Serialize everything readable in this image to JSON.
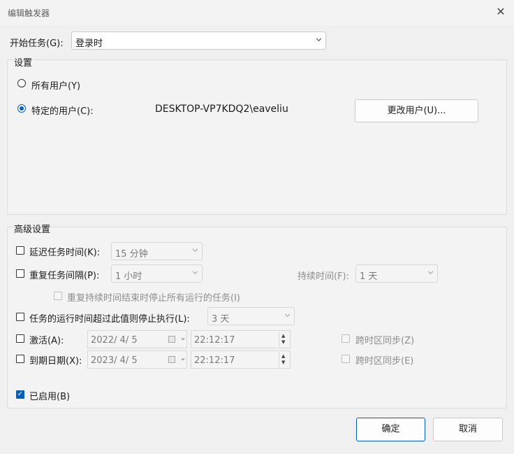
{
  "window": {
    "title": "编辑触发器",
    "close_icon": "close-icon"
  },
  "start_task": {
    "label": "开始任务(G):",
    "value": "登录时"
  },
  "settings": {
    "group_label": "设置",
    "all_users_label": "所有用户(Y)",
    "specific_user_label": "特定的用户(C):",
    "user_value": "DESKTOP-VP7KDQ2\\eaveliu",
    "change_user_button": "更改用户(U)..."
  },
  "advanced": {
    "group_label": "高级设置",
    "delay_label": "延迟任务时间(K):",
    "delay_value": "15 分钟",
    "repeat_label": "重复任务间隔(P):",
    "repeat_value": "1 小时",
    "duration_label": "持续时间(F):",
    "duration_value": "1 天",
    "stop_all_label": "重复持续时间结束时停止所有运行的任务(I)",
    "stop_if_label": "任务的运行时间超过此值则停止执行(L):",
    "stop_if_value": "3 天",
    "activate_label": "激活(A):",
    "activate_date": "2022/  4/  5",
    "activate_time": "22:12:17",
    "activate_sync_label": "跨时区同步(Z)",
    "expire_label": "到期日期(X):",
    "expire_date": "2023/  4/  5",
    "expire_time": "22:12:17",
    "expire_sync_label": "跨时区同步(E)",
    "enabled_label": "已启用(B)"
  },
  "buttons": {
    "ok": "确定",
    "cancel": "取消"
  },
  "colors": {
    "accent": "#005fb8",
    "window_bg": "#f0f0f0"
  }
}
